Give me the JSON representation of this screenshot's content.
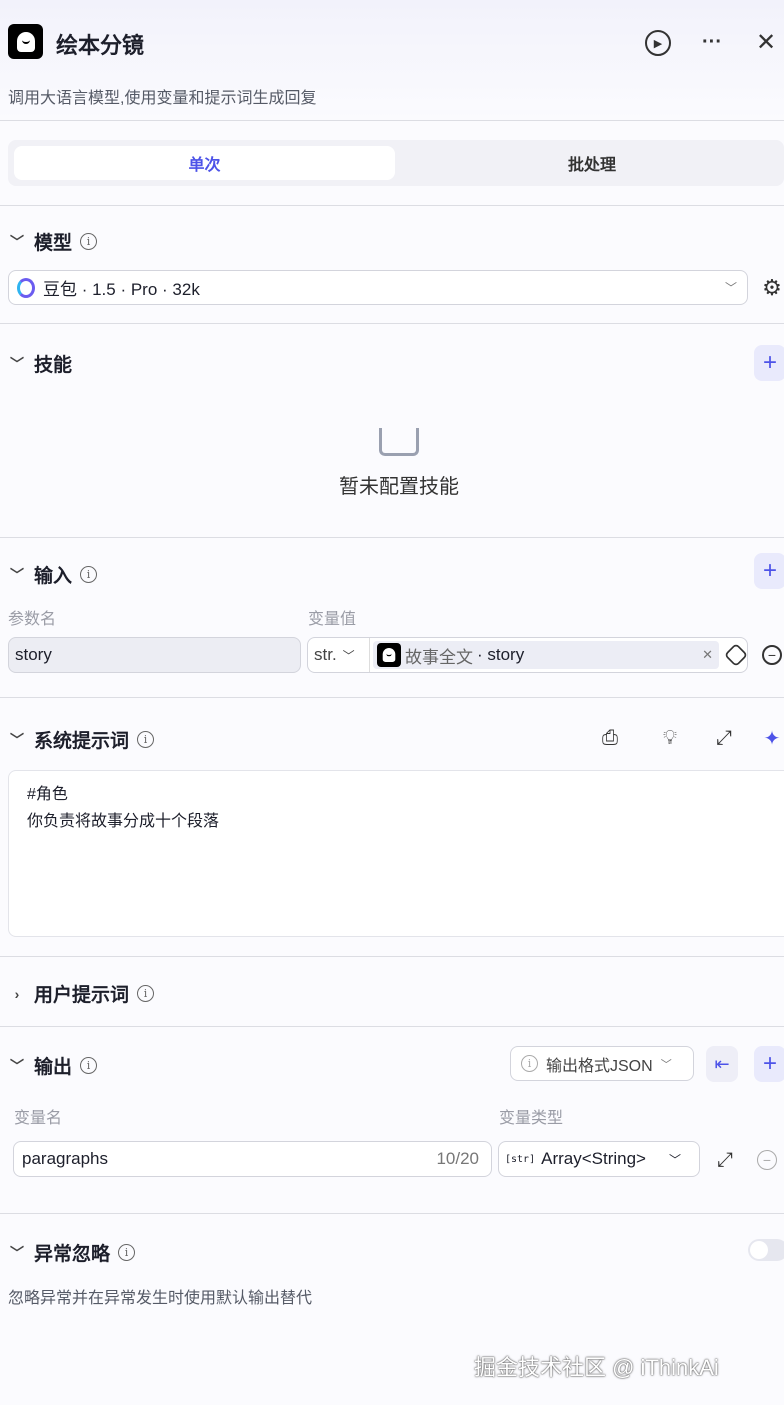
{
  "header": {
    "title": "绘本分镜",
    "description": "调用大语言模型,使用变量和提示词生成回复"
  },
  "tabs": [
    "单次",
    "批处理"
  ],
  "model": {
    "label": "模型",
    "value": "豆包 · 1.5 · Pro · 32k"
  },
  "skills": {
    "label": "技能",
    "empty": "暂未配置技能"
  },
  "input": {
    "label": "输入",
    "col_name": "参数名",
    "col_value": "变量值",
    "rows": [
      {
        "name": "story",
        "type": "str.",
        "ref_source": "故事全文",
        "ref_var": "· story"
      }
    ]
  },
  "system_prompt": {
    "label": "系统提示词",
    "lines": [
      "#角色",
      "你负责将故事分成十个段落"
    ]
  },
  "user_prompt": {
    "label": "用户提示词"
  },
  "output": {
    "label": "输出",
    "format": "输出格式JSON",
    "col_name": "变量名",
    "col_type": "变量类型",
    "rows": [
      {
        "name": "paragraphs",
        "count": "10/20",
        "type_icon": "[str]",
        "type": "Array<String>"
      }
    ]
  },
  "exception": {
    "label": "异常忽略",
    "description": "忽略异常并在异常发生时使用默认输出替代",
    "enabled": false
  },
  "watermark": "掘金技术社区 @ iThinkAi"
}
